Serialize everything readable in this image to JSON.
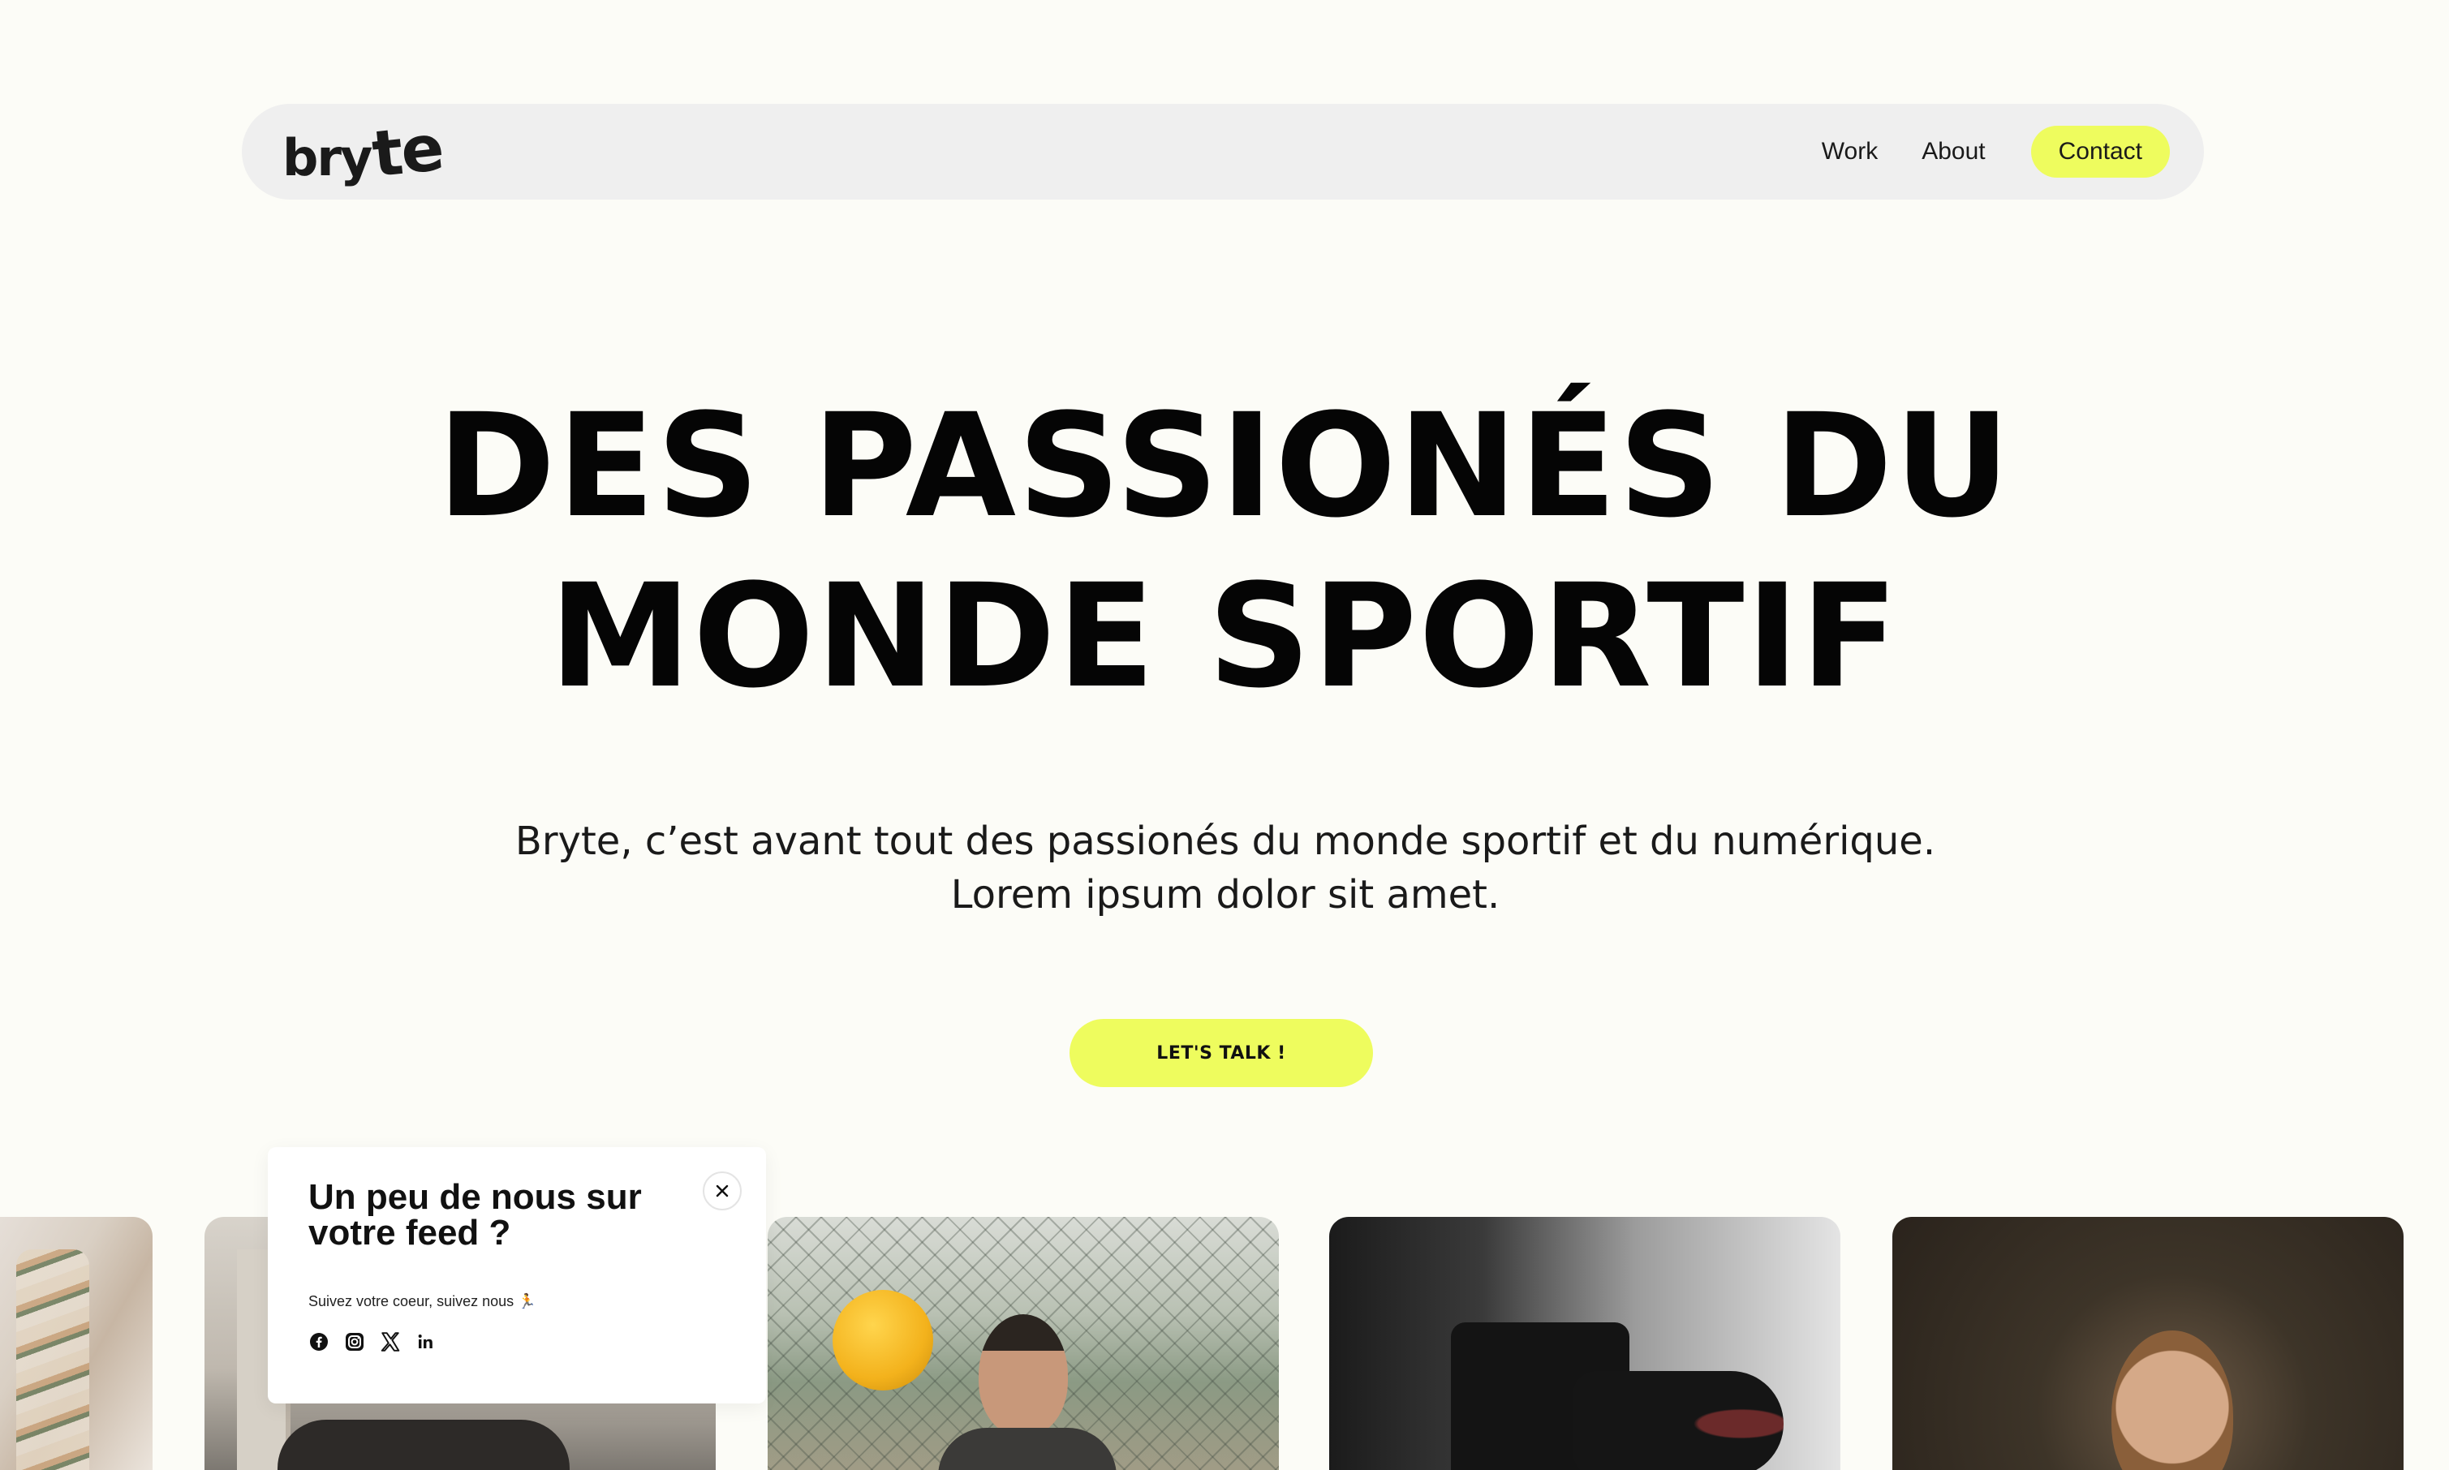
{
  "nav": {
    "logo_main": "bry",
    "logo_accent": "te",
    "links": [
      {
        "label": "Work"
      },
      {
        "label": "About"
      }
    ],
    "contact_label": "Contact"
  },
  "hero": {
    "title_line1": "DES PASSIONÉS DU",
    "title_line2": "MONDE SPORTIF",
    "subtitle": "Bryte, c’est avant tout des passionés du monde sportif et du numérique. Lorem ipsum dolor sit amet.",
    "cta_label": "LET'S TALK !"
  },
  "popup": {
    "title": "Un peu de nous sur votre feed ?",
    "text": "Suivez votre coeur, suivez nous 🏃",
    "icons": [
      "facebook-icon",
      "instagram-icon",
      "x-icon",
      "linkedin-icon"
    ]
  },
  "colors": {
    "background": "#fcfcf7",
    "accent": "#eefc5e",
    "nav_bg": "#efefef"
  }
}
